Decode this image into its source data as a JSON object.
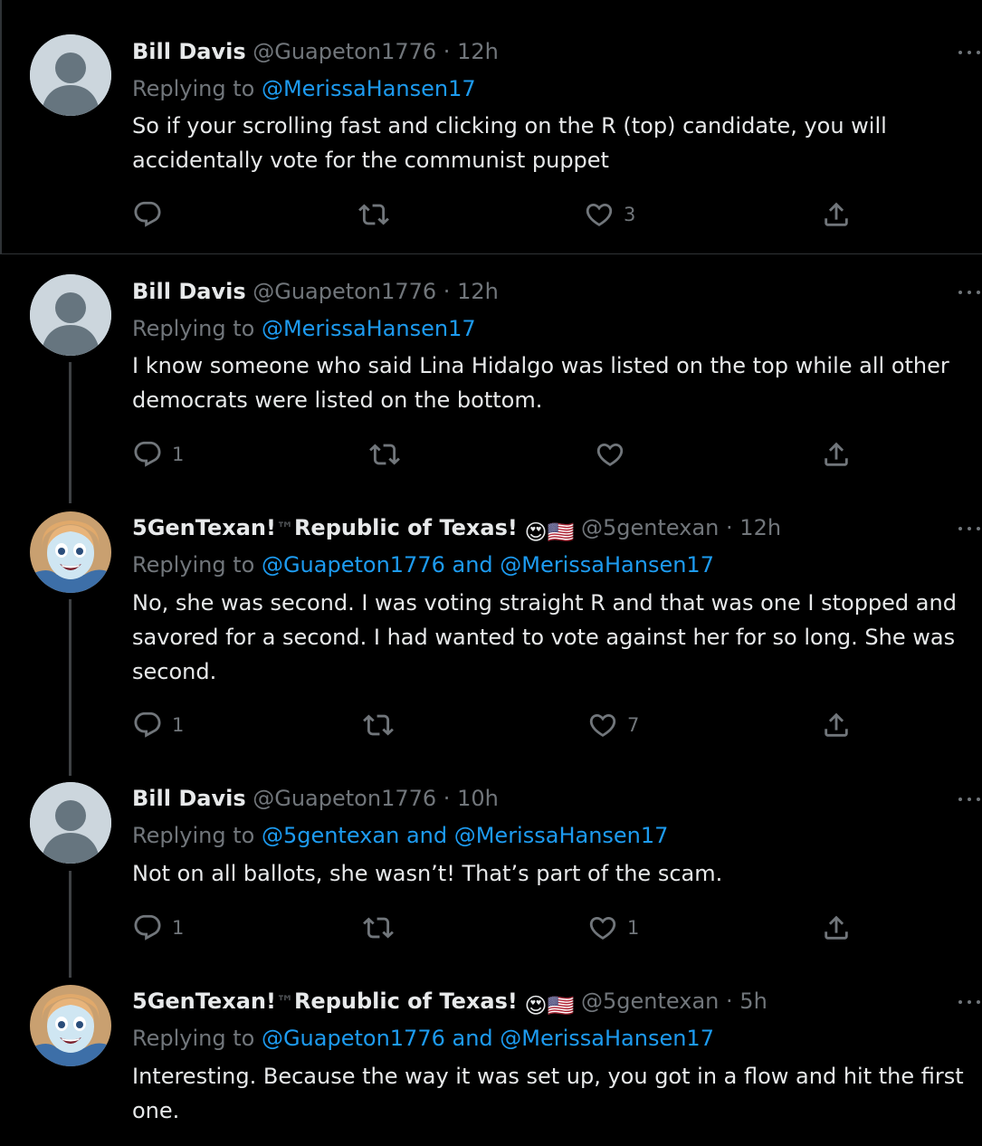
{
  "colors": {
    "background": "#000000",
    "text": "#e7e9ea",
    "muted": "#71767b",
    "link": "#1d9bf0",
    "thread_line": "#3e4144",
    "divider": "#2f3336"
  },
  "icons": {
    "reply": "reply-icon",
    "retweet": "retweet-icon",
    "like": "heart-icon",
    "share": "share-icon",
    "more": "more-icon"
  },
  "tweets": [
    {
      "name": "Bill Davis",
      "handle": "@Guapeton1776",
      "sep": "·",
      "time": "12h",
      "replying_prefix": "Replying to",
      "mentions": "@MerissaHansen17",
      "text": "So if your scrolling fast and clicking on the R (top) candidate, you will accidentally vote for the communist puppet",
      "reply_count": "",
      "retweet_count": "",
      "like_count": "3"
    },
    {
      "name": "Bill Davis",
      "handle": "@Guapeton1776",
      "sep": "·",
      "time": "12h",
      "replying_prefix": "Replying to",
      "mentions": "@MerissaHansen17",
      "text": "I know someone who said Lina Hidalgo was listed on the top while all other democrats were listed on the bottom.",
      "reply_count": "1",
      "retweet_count": "",
      "like_count": ""
    },
    {
      "name": "5GenTexan!",
      "name_tm": "™",
      "name_rest": "Republic of Texas!",
      "name_emojis": "😍🇺🇸",
      "handle": "@5gentexan",
      "sep": "·",
      "time": "12h",
      "replying_prefix": "Replying to",
      "mentions": "@Guapeton1776 and @MerissaHansen17",
      "text": "No, she was second.  I was voting straight R and that was one I stopped and savored for a second.  I had wanted to vote against her for so long.  She was second.",
      "reply_count": "1",
      "retweet_count": "",
      "like_count": "7"
    },
    {
      "name": "Bill Davis",
      "handle": "@Guapeton1776",
      "sep": "·",
      "time": "10h",
      "replying_prefix": "Replying to",
      "mentions": "@5gentexan and @MerissaHansen17",
      "text": "Not on all ballots, she wasn’t! That’s part of the scam.",
      "reply_count": "1",
      "retweet_count": "",
      "like_count": "1"
    },
    {
      "name": "5GenTexan!",
      "name_tm": "™",
      "name_rest": "Republic of Texas!",
      "name_emojis": "😍🇺🇸",
      "handle": "@5gentexan",
      "sep": "·",
      "time": "5h",
      "replying_prefix": "Replying to",
      "mentions": "@Guapeton1776 and @MerissaHansen17",
      "text": "Interesting.  Because the way it was set up, you got in a flow and hit the first one.",
      "reply_count": "",
      "retweet_count": "",
      "like_count": ""
    }
  ]
}
